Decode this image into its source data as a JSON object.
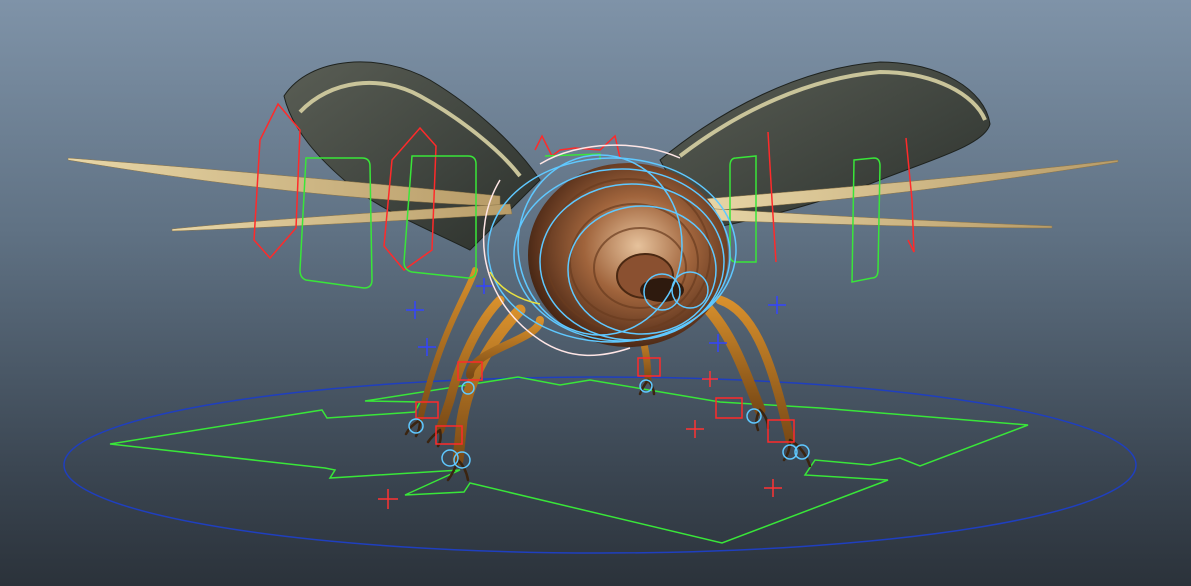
{
  "viewport": {
    "background_top": "#7f93a8",
    "background_bottom": "#2b323a"
  },
  "colors": {
    "ik_control": "#ff2a2a",
    "fk_control": "#39e639",
    "body_control": "#5fc8ff",
    "root_control": "#1f3fbf",
    "locator": "#3344ff",
    "pivot": "#ff3333"
  },
  "rig": {
    "wing_controls": [
      "left-outer",
      "left-inner",
      "right-inner",
      "right-outer"
    ],
    "leg_controls": [
      "front-left",
      "front-right",
      "mid-left",
      "mid-right",
      "rear-left",
      "rear-right"
    ]
  }
}
